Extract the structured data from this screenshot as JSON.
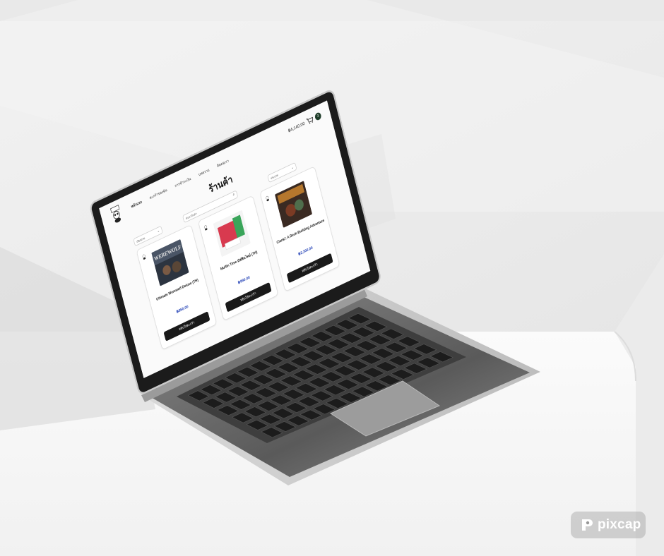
{
  "site": {
    "nav": [
      "หน้าแรก",
      "ตะกร้าของฉัน",
      "การชำระเงิน",
      "บทความ",
      "ติดต่อเรา"
    ],
    "cart_total": "฿4,140.00",
    "cart_count": "3",
    "page_title": "ร้านค้า",
    "search_placeholder": "ค้นหาสินค้า",
    "filter_left": "เรียงตาม",
    "filter_right": "ประเภท"
  },
  "products": [
    {
      "name": "Ultimate Werewolf Deluxe (TH)",
      "price": "฿850.00",
      "button": "หยิบใส่ตะกร้า",
      "art": "werewolf"
    },
    {
      "name": "Muffin Time มัฟฟินไทม์ (TH)",
      "price": "฿990.00",
      "button": "หยิบใส่ตะกร้า",
      "art": "muffin"
    },
    {
      "name": "Clank!: A Deck-Building Adventure",
      "price": "฿2,300.00",
      "button": "หยิบใส่ตะกร้า",
      "art": "clank"
    }
  ],
  "watermark": "pixcap",
  "colors": {
    "accent_price": "#2846b8",
    "badge": "#1f3d2a",
    "button": "#1a1a1a"
  }
}
